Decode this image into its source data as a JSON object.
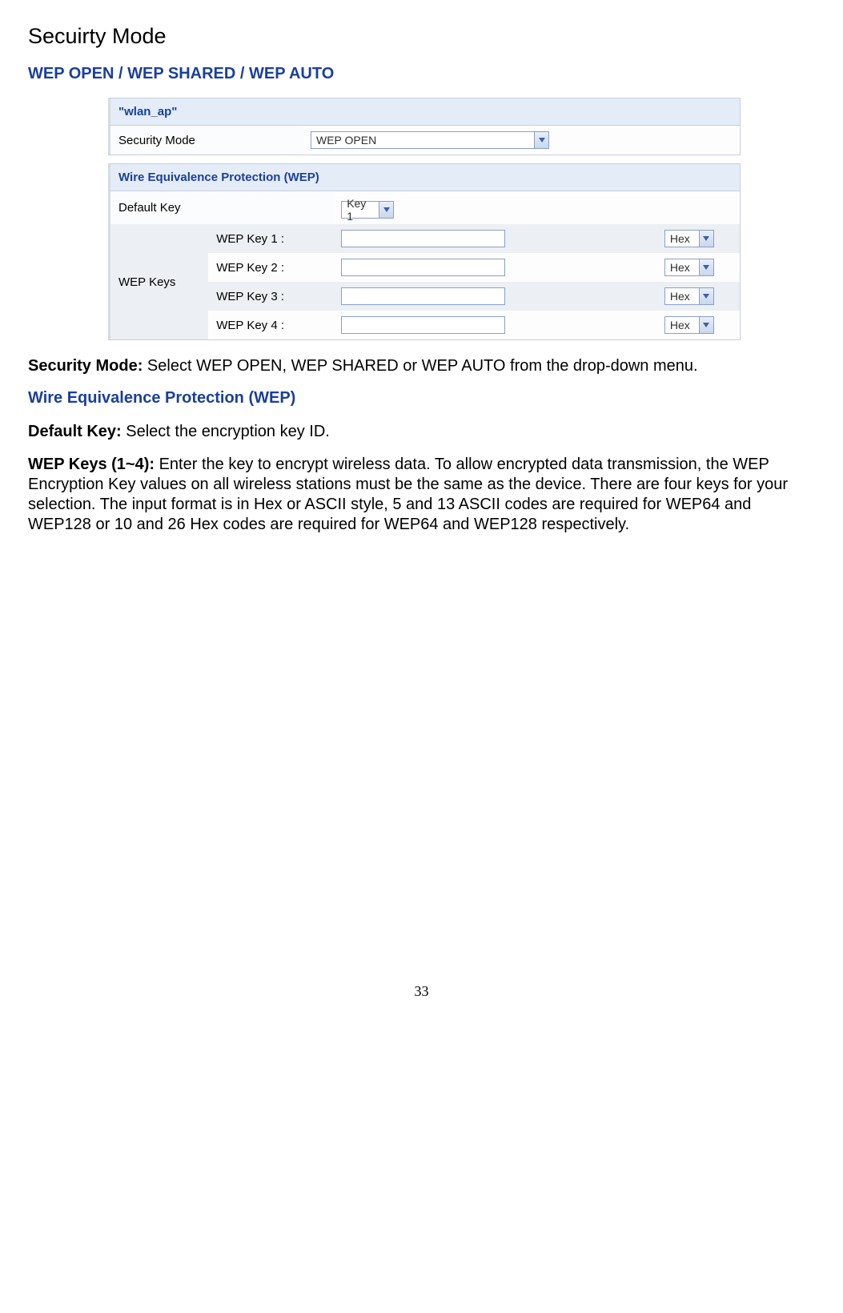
{
  "page_title": "Secuirty Mode",
  "heading_wep": "WEP OPEN / WEP SHARED / WEP AUTO",
  "panel1": {
    "header": "\"wlan_ap\"",
    "security_mode_label": "Security Mode",
    "security_mode_value": "WEP OPEN"
  },
  "panel2": {
    "header": "Wire Equivalence Protection (WEP)",
    "default_key_label": "Default Key",
    "default_key_value": "Key 1",
    "wep_keys_label": "WEP Keys",
    "keys": [
      {
        "label": "WEP Key 1 :",
        "format": "Hex"
      },
      {
        "label": "WEP Key 2 :",
        "format": "Hex"
      },
      {
        "label": "WEP Key 3 :",
        "format": "Hex"
      },
      {
        "label": "WEP Key 4 :",
        "format": "Hex"
      }
    ]
  },
  "para_sec_mode_label": "Security Mode: ",
  "para_sec_mode_body": "Select WEP OPEN, WEP SHARED or WEP AUTO from the drop-down menu.",
  "heading_wep_section": "Wire Equivalence Protection (WEP)",
  "para_default_key_label": "Default Key: ",
  "para_default_key_body": "Select the encryption key ID.",
  "para_wep_keys_label": "WEP Keys (1~4): ",
  "para_wep_keys_body": "Enter the key to encrypt wireless data. To allow encrypted data transmission, the WEP Encryption Key values on all wireless stations must be the same as the device. There are four keys for your selection. The input format is in Hex or ASCII style, 5 and 13 ASCII codes are required for WEP64 and WEP128 or 10 and 26 Hex codes are required for WEP64 and WEP128 respectively.",
  "page_number": "33"
}
